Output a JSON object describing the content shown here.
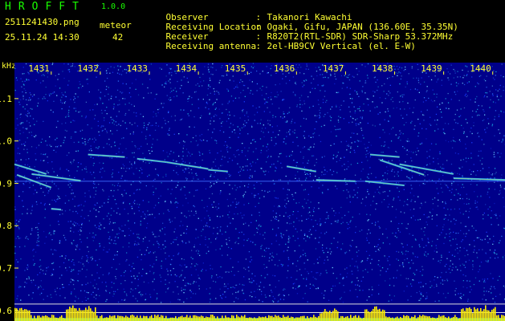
{
  "app": {
    "title": "HROFFT",
    "version": "1.0.0"
  },
  "file": {
    "name": "2511241430.png",
    "datetime": "25.11.24 14:30"
  },
  "meteor": {
    "label": "meteor",
    "count": "42"
  },
  "info": [
    {
      "label": "Observer",
      "value": "Takanori Kawachi"
    },
    {
      "label": "Receiving Location",
      "value": "Ogaki, Gifu, JAPAN (136.60E, 35.35N)"
    },
    {
      "label": "Receiver",
      "value": "R820T2(RTL-SDR) SDR-Sharp 53.372MHz"
    },
    {
      "label": "Receiving antenna",
      "value": "2el-HB9CV Vertical (el. E-W)"
    }
  ],
  "y_unit": "kHz",
  "chart_data": {
    "type": "heatmap",
    "x_ticks": [
      "1431",
      "1432",
      "1433",
      "1434",
      "1435",
      "1436",
      "1437",
      "1438",
      "1439",
      "1440"
    ],
    "y_ticks": [
      "1.1",
      "1.0",
      "0.9",
      "0.8",
      "0.7",
      "0.6"
    ],
    "xlim": [
      1430.25,
      1440.25
    ],
    "ylim": [
      0.575,
      1.185
    ],
    "carrier_khz": 0.905,
    "reference_lines_khz": [
      0.615,
      0.595
    ],
    "echoes": [
      {
        "x": [
          1430.25,
          1430.9
        ],
        "y": [
          0.945,
          0.922
        ]
      },
      {
        "x": [
          1430.6,
          1431.6
        ],
        "y": [
          0.922,
          0.906
        ]
      },
      {
        "x": [
          1430.3,
          1431.0
        ],
        "y": [
          0.92,
          0.89
        ]
      },
      {
        "x": [
          1431.75,
          1432.5
        ],
        "y": [
          0.968,
          0.962
        ]
      },
      {
        "x": [
          1432.75,
          1433.35
        ],
        "y": [
          0.958,
          0.95
        ]
      },
      {
        "x": [
          1433.35,
          1434.2
        ],
        "y": [
          0.95,
          0.934
        ]
      },
      {
        "x": [
          1434.2,
          1434.6
        ],
        "y": [
          0.932,
          0.928
        ]
      },
      {
        "x": [
          1435.8,
          1436.4
        ],
        "y": [
          0.94,
          0.928
        ]
      },
      {
        "x": [
          1436.4,
          1437.2
        ],
        "y": [
          0.908,
          0.905
        ]
      },
      {
        "x": [
          1437.5,
          1438.1
        ],
        "y": [
          0.968,
          0.962
        ]
      },
      {
        "x": [
          1437.7,
          1438.6
        ],
        "y": [
          0.955,
          0.92
        ]
      },
      {
        "x": [
          1438.1,
          1439.2
        ],
        "y": [
          0.945,
          0.922
        ]
      },
      {
        "x": [
          1437.4,
          1438.2
        ],
        "y": [
          0.905,
          0.895
        ]
      },
      {
        "x": [
          1439.2,
          1440.25
        ],
        "y": [
          0.912,
          0.908
        ]
      },
      {
        "x": [
          1431.0,
          1431.2
        ],
        "y": [
          0.84,
          0.838
        ]
      }
    ],
    "colors": {
      "background": "#00008a",
      "noise": [
        "#1a3dff",
        "#2f7dff",
        "#1aa8e0",
        "#6fd3ff"
      ],
      "echo": "#31c8ff",
      "echo_core": "#ffee44",
      "carrier": "#3b6bff",
      "ticks": "#ffff33",
      "reference_lines": "#dddddd",
      "signal_bars": "#ffee00",
      "baseline": "#00c8ff"
    }
  }
}
